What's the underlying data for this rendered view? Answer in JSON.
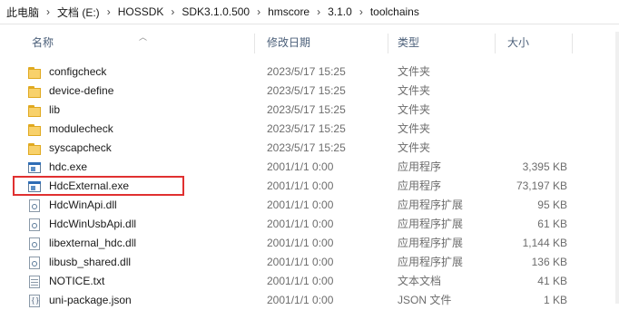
{
  "breadcrumb": [
    {
      "label": "此电脑"
    },
    {
      "label": "文档 (E:)"
    },
    {
      "label": "HOSSDK"
    },
    {
      "label": "SDK3.1.0.500"
    },
    {
      "label": "hmscore"
    },
    {
      "label": "3.1.0"
    },
    {
      "label": "toolchains"
    }
  ],
  "columns": {
    "name": "名称",
    "date": "修改日期",
    "type": "类型",
    "size": "大小"
  },
  "files": [
    {
      "name": "configcheck",
      "date": "2023/5/17 15:25",
      "type": "文件夹",
      "size": "",
      "icon": "folder-icon"
    },
    {
      "name": "device-define",
      "date": "2023/5/17 15:25",
      "type": "文件夹",
      "size": "",
      "icon": "folder-icon"
    },
    {
      "name": "lib",
      "date": "2023/5/17 15:25",
      "type": "文件夹",
      "size": "",
      "icon": "folder-icon"
    },
    {
      "name": "modulecheck",
      "date": "2023/5/17 15:25",
      "type": "文件夹",
      "size": "",
      "icon": "folder-icon"
    },
    {
      "name": "syscapcheck",
      "date": "2023/5/17 15:25",
      "type": "文件夹",
      "size": "",
      "icon": "folder-icon"
    },
    {
      "name": "hdc.exe",
      "date": "2001/1/1 0:00",
      "type": "应用程序",
      "size": "3,395 KB",
      "icon": "exe-icon"
    },
    {
      "name": "HdcExternal.exe",
      "date": "2001/1/1 0:00",
      "type": "应用程序",
      "size": "73,197 KB",
      "icon": "exe-icon"
    },
    {
      "name": "HdcWinApi.dll",
      "date": "2001/1/1 0:00",
      "type": "应用程序扩展",
      "size": "95 KB",
      "icon": "dll-icon"
    },
    {
      "name": "HdcWinUsbApi.dll",
      "date": "2001/1/1 0:00",
      "type": "应用程序扩展",
      "size": "61 KB",
      "icon": "dll-icon"
    },
    {
      "name": "libexternal_hdc.dll",
      "date": "2001/1/1 0:00",
      "type": "应用程序扩展",
      "size": "1,144 KB",
      "icon": "dll-icon"
    },
    {
      "name": "libusb_shared.dll",
      "date": "2001/1/1 0:00",
      "type": "应用程序扩展",
      "size": "136 KB",
      "icon": "dll-icon"
    },
    {
      "name": "NOTICE.txt",
      "date": "2001/1/1 0:00",
      "type": "文本文档",
      "size": "41 KB",
      "icon": "txt-icon"
    },
    {
      "name": "uni-package.json",
      "date": "2001/1/1 0:00",
      "type": "JSON 文件",
      "size": "1 KB",
      "icon": "json-icon"
    }
  ],
  "highlight_color": "#e03030"
}
